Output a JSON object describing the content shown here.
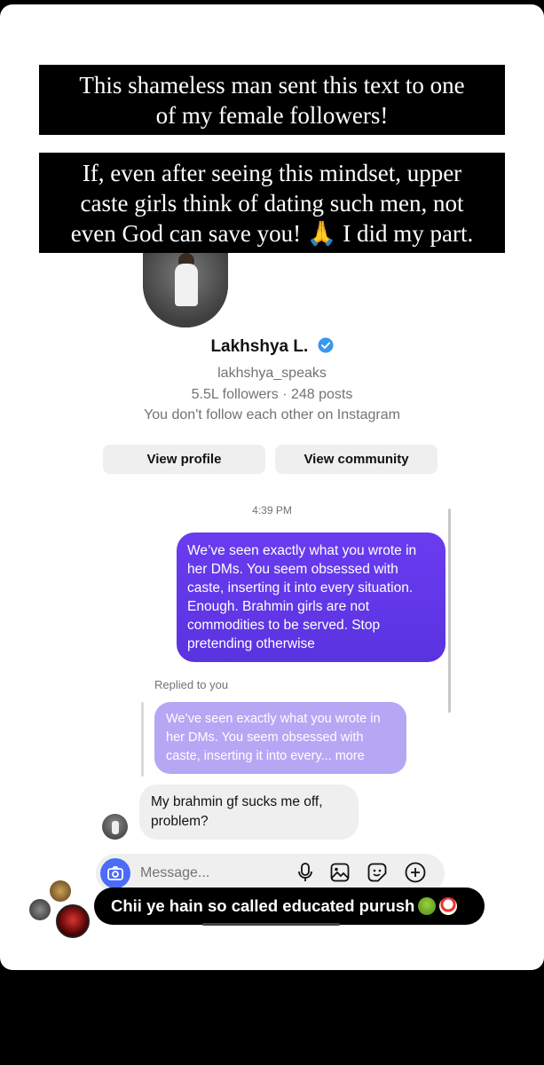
{
  "caption": {
    "line1": [
      "This shameless man sent this text to one",
      "of my female followers!"
    ],
    "line2": [
      "If, even after seeing this mindset, upper",
      "caste girls think of dating such men, not",
      "even God can save you! 🙏 I did my part."
    ]
  },
  "profile": {
    "name": "Lakhshya L.",
    "handle": "lakhshya_speaks",
    "stats": "5.5L followers · 248 posts",
    "follow_note": "You don't follow each other on Instagram",
    "view_profile": "View profile",
    "view_community": "View community"
  },
  "chat": {
    "timestamp": "4:39 PM",
    "outgoing": "We’ve seen exactly what you wrote in her DMs. You seem obsessed with caste, inserting it into every situation. Enough. Brahmin girls are not commodities to be served. Stop pretending otherwise",
    "replied_label": "Replied to you",
    "quoted": "We’ve seen exactly what you wrote in her DMs. You seem obsessed with caste, inserting it into every... more",
    "incoming": "My brahmin gf sucks me off, problem?"
  },
  "composer": {
    "placeholder": "Message..."
  },
  "story_reply": {
    "text": "Chii ye hain so called educated purush"
  },
  "colors": {
    "accent_purple": "#5a33e0",
    "verified_blue": "#3897f0",
    "camera_blue": "#4a6cf7"
  }
}
